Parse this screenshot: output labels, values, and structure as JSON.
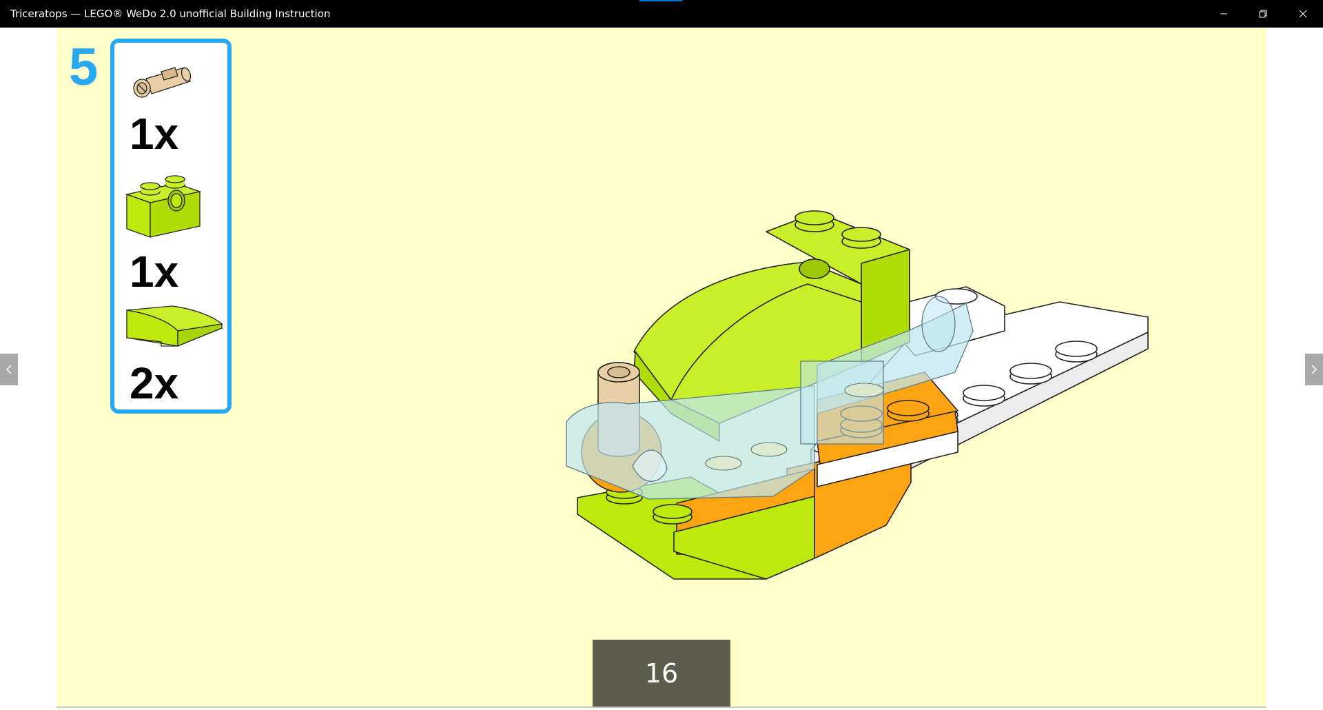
{
  "window": {
    "title": "Triceratops — LEGO® WeDo 2.0 unofficial Building Instruction",
    "accent_color": "#0078d7",
    "minimize_icon": "minimize-icon",
    "restore_icon": "restore-icon",
    "close_icon": "close-icon"
  },
  "step": {
    "number": "5",
    "color": "#29a8f2"
  },
  "parts": [
    {
      "icon": "tan-axle-pin-icon",
      "quantity": "1x"
    },
    {
      "icon": "lime-technic-brick-1x2-icon",
      "quantity": "1x"
    },
    {
      "icon": "lime-curved-slope-icon",
      "quantity": "2x"
    }
  ],
  "model": {
    "icon": "triceratops-assembly-step-icon"
  },
  "pagination": {
    "current_page": "16",
    "prev_icon": "chevron-left-icon",
    "next_icon": "chevron-right-icon"
  },
  "colors": {
    "page_background": "#ffffcc",
    "lime": "#bde90c",
    "orange": "#ffa514",
    "tan": "#e8cfa6",
    "trans_light_blue": "#bfe6f0"
  }
}
